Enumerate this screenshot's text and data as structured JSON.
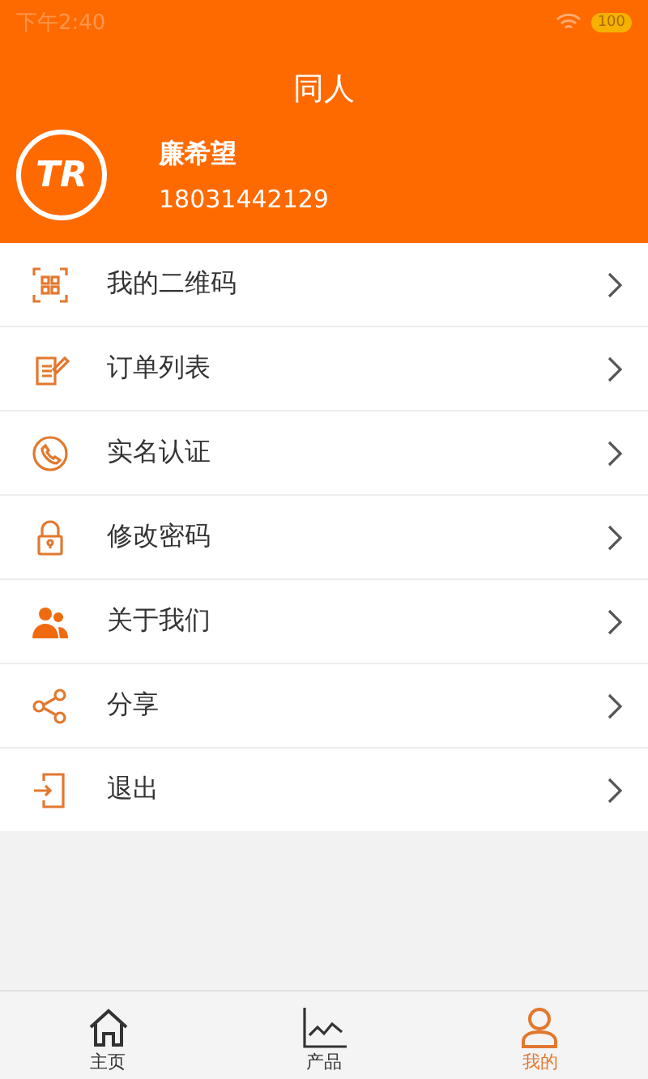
{
  "status_bar": {
    "time": "下午2:40",
    "battery": "100"
  },
  "header": {
    "title": "同人"
  },
  "profile": {
    "logo_text": "TR",
    "name": "廉希望",
    "phone": "18031442129"
  },
  "menu": [
    {
      "label": "我的二维码"
    },
    {
      "label": "订单列表"
    },
    {
      "label": "实名认证"
    },
    {
      "label": "修改密码"
    },
    {
      "label": "关于我们"
    },
    {
      "label": "分享"
    },
    {
      "label": "退出"
    }
  ],
  "tabs": [
    {
      "label": "主页",
      "selected": false
    },
    {
      "label": "产品",
      "selected": false
    },
    {
      "label": "我的",
      "selected": true
    }
  ]
}
